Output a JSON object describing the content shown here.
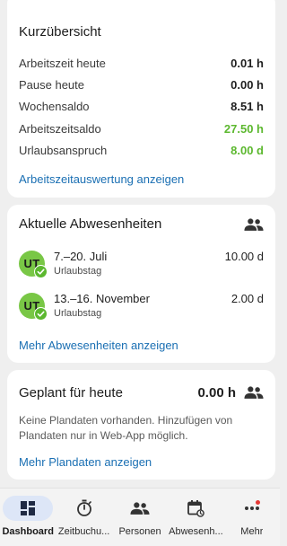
{
  "summary": {
    "title": "Kurzübersicht",
    "rows": [
      {
        "label": "Arbeitszeit heute",
        "value": "0.01 h",
        "color": "#1f1f1f"
      },
      {
        "label": "Pause heute",
        "value": "0.00 h",
        "color": "#1f1f1f"
      },
      {
        "label": "Wochensaldo",
        "value": "8.51 h",
        "color": "#1f1f1f"
      },
      {
        "label": "Arbeitszeitsaldo",
        "value": "27.50 h",
        "color": "#5cb82f"
      },
      {
        "label": "Urlaubsanspruch",
        "value": "8.00 d",
        "color": "#5cb82f"
      }
    ],
    "link": "Arbeitszeitauswertung anzeigen"
  },
  "absences": {
    "title": "Aktuelle Abwesenheiten",
    "icon": "people-icon",
    "items": [
      {
        "initials": "UT",
        "dates": "7.–20. Juli",
        "type": "Urlaubstag",
        "duration": "10.00 d"
      },
      {
        "initials": "UT",
        "dates": "13.–16. November",
        "type": "Urlaubstag",
        "duration": "2.00 d"
      }
    ],
    "link": "Mehr Abwesenheiten anzeigen"
  },
  "planned": {
    "title": "Geplant für heute",
    "value": "0.00 h",
    "icon": "people-icon",
    "note": "Keine Plandaten vorhanden. Hinzufügen von Plandaten nur in Web-App möglich.",
    "link": "Mehr Plandaten anzeigen"
  },
  "nav": {
    "items": [
      {
        "label": "Dashboard",
        "icon": "dashboard-icon",
        "active": true
      },
      {
        "label": "Zeitbuchu...",
        "icon": "stopwatch-icon",
        "active": false
      },
      {
        "label": "Personen",
        "icon": "people-icon",
        "active": false
      },
      {
        "label": "Abwesenh...",
        "icon": "calendar-icon",
        "active": false
      },
      {
        "label": "Mehr",
        "icon": "more-icon",
        "active": false,
        "badge": true
      }
    ]
  },
  "colors": {
    "accent": "#1a6fb3",
    "positive": "#5cb82f",
    "avatar": "#79c746",
    "active_nav_bg": "#dde6f7"
  }
}
